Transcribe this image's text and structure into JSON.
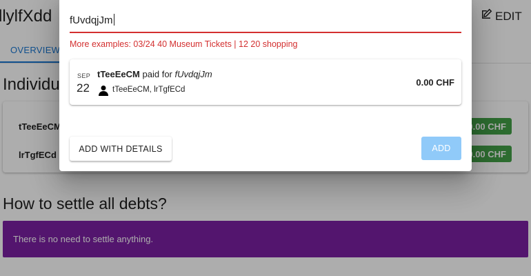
{
  "background": {
    "title": "llylfXdd",
    "edit_label": "EDIT",
    "tab_overview": "OVERVIEW",
    "section_title": "Individu",
    "balances": [
      {
        "name": "tTeeEeCM",
        "amount": "0.00 CHF"
      },
      {
        "name": "lrTgfECd",
        "amount": "0.00 CHF"
      }
    ],
    "settle_title": "How to settle all debts?",
    "settle_message": "There is no need to settle anything."
  },
  "dialog": {
    "input_value": "fUvdqjJm",
    "hint": "More examples: 03/24 40 Museum Tickets | 12 20 shopping",
    "preview": {
      "month": "SEP",
      "day": "22",
      "payer": "tTeeEeCM",
      "paid_for_text": "paid for",
      "description": "fUvdqjJm",
      "participants": "tTeeEeCM, lrTgfECd",
      "amount": "0.00 CHF"
    },
    "details_button": "ADD WITH DETAILS",
    "add_button": "ADD"
  },
  "colors": {
    "primary": "#1976d2",
    "error": "#d32f2f",
    "success": "#43a047",
    "settle_banner": "#7b1fa2",
    "add_disabled": "#90caf9"
  },
  "icons": {
    "edit": "edit-icon",
    "person": "person-icon"
  }
}
